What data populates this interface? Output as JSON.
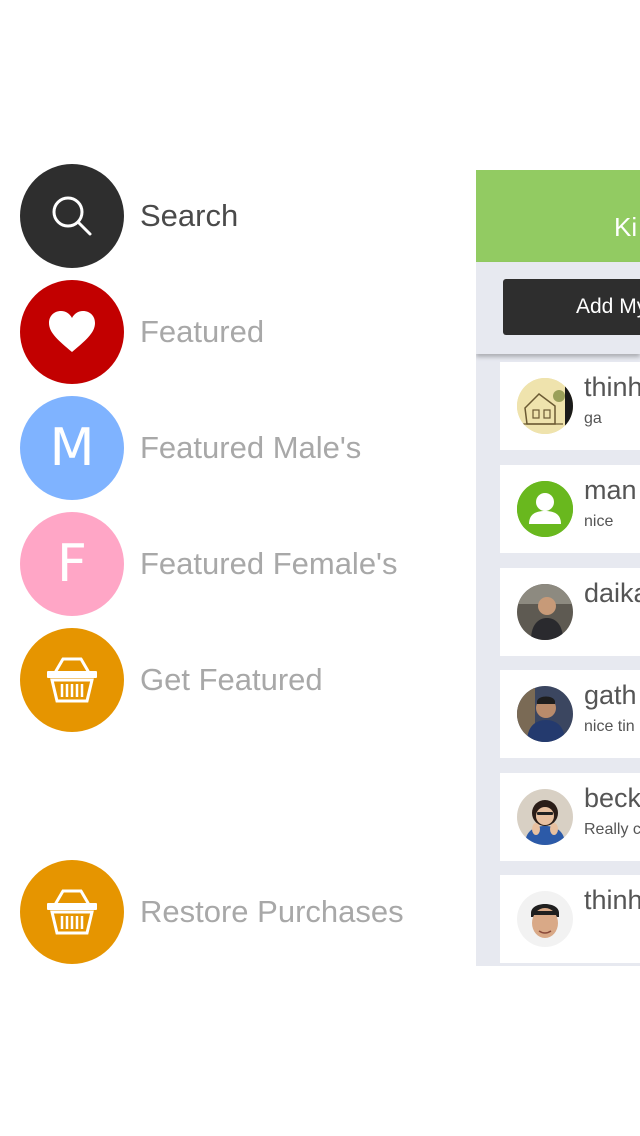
{
  "menu": {
    "items": [
      {
        "label": "Search",
        "icon": "search-icon",
        "color": "#2e2e2e",
        "active": true
      },
      {
        "label": "Featured",
        "icon": "heart-icon",
        "color": "#c20000"
      },
      {
        "label": "Featured Male's",
        "icon": "male-letter-icon",
        "letter": "M",
        "color": "#7fb3ff"
      },
      {
        "label": "Featured Female's",
        "icon": "female-letter-icon",
        "letter": "F",
        "color": "#ffa6c6"
      },
      {
        "label": "Get Featured",
        "icon": "basket-icon",
        "color": "#e69500"
      },
      {
        "label": "Restore Purchases",
        "icon": "basket-icon",
        "color": "#e69500"
      }
    ]
  },
  "panel": {
    "title": "Ki",
    "add_button_label": "Add My",
    "header_color": "#92cb62",
    "feed": [
      {
        "name": "thinh",
        "message": "ga",
        "avatar": "house-sketch-avatar"
      },
      {
        "name": "man",
        "message": "nice",
        "avatar": "default-user-avatar"
      },
      {
        "name": "daika",
        "message": "",
        "avatar": "photo-avatar"
      },
      {
        "name": "gath",
        "message": "nice tin",
        "avatar": "photo-avatar"
      },
      {
        "name": "beck",
        "message": "Really c",
        "avatar": "photo-avatar"
      },
      {
        "name": "thinh",
        "message": "",
        "avatar": "photo-avatar"
      }
    ]
  }
}
